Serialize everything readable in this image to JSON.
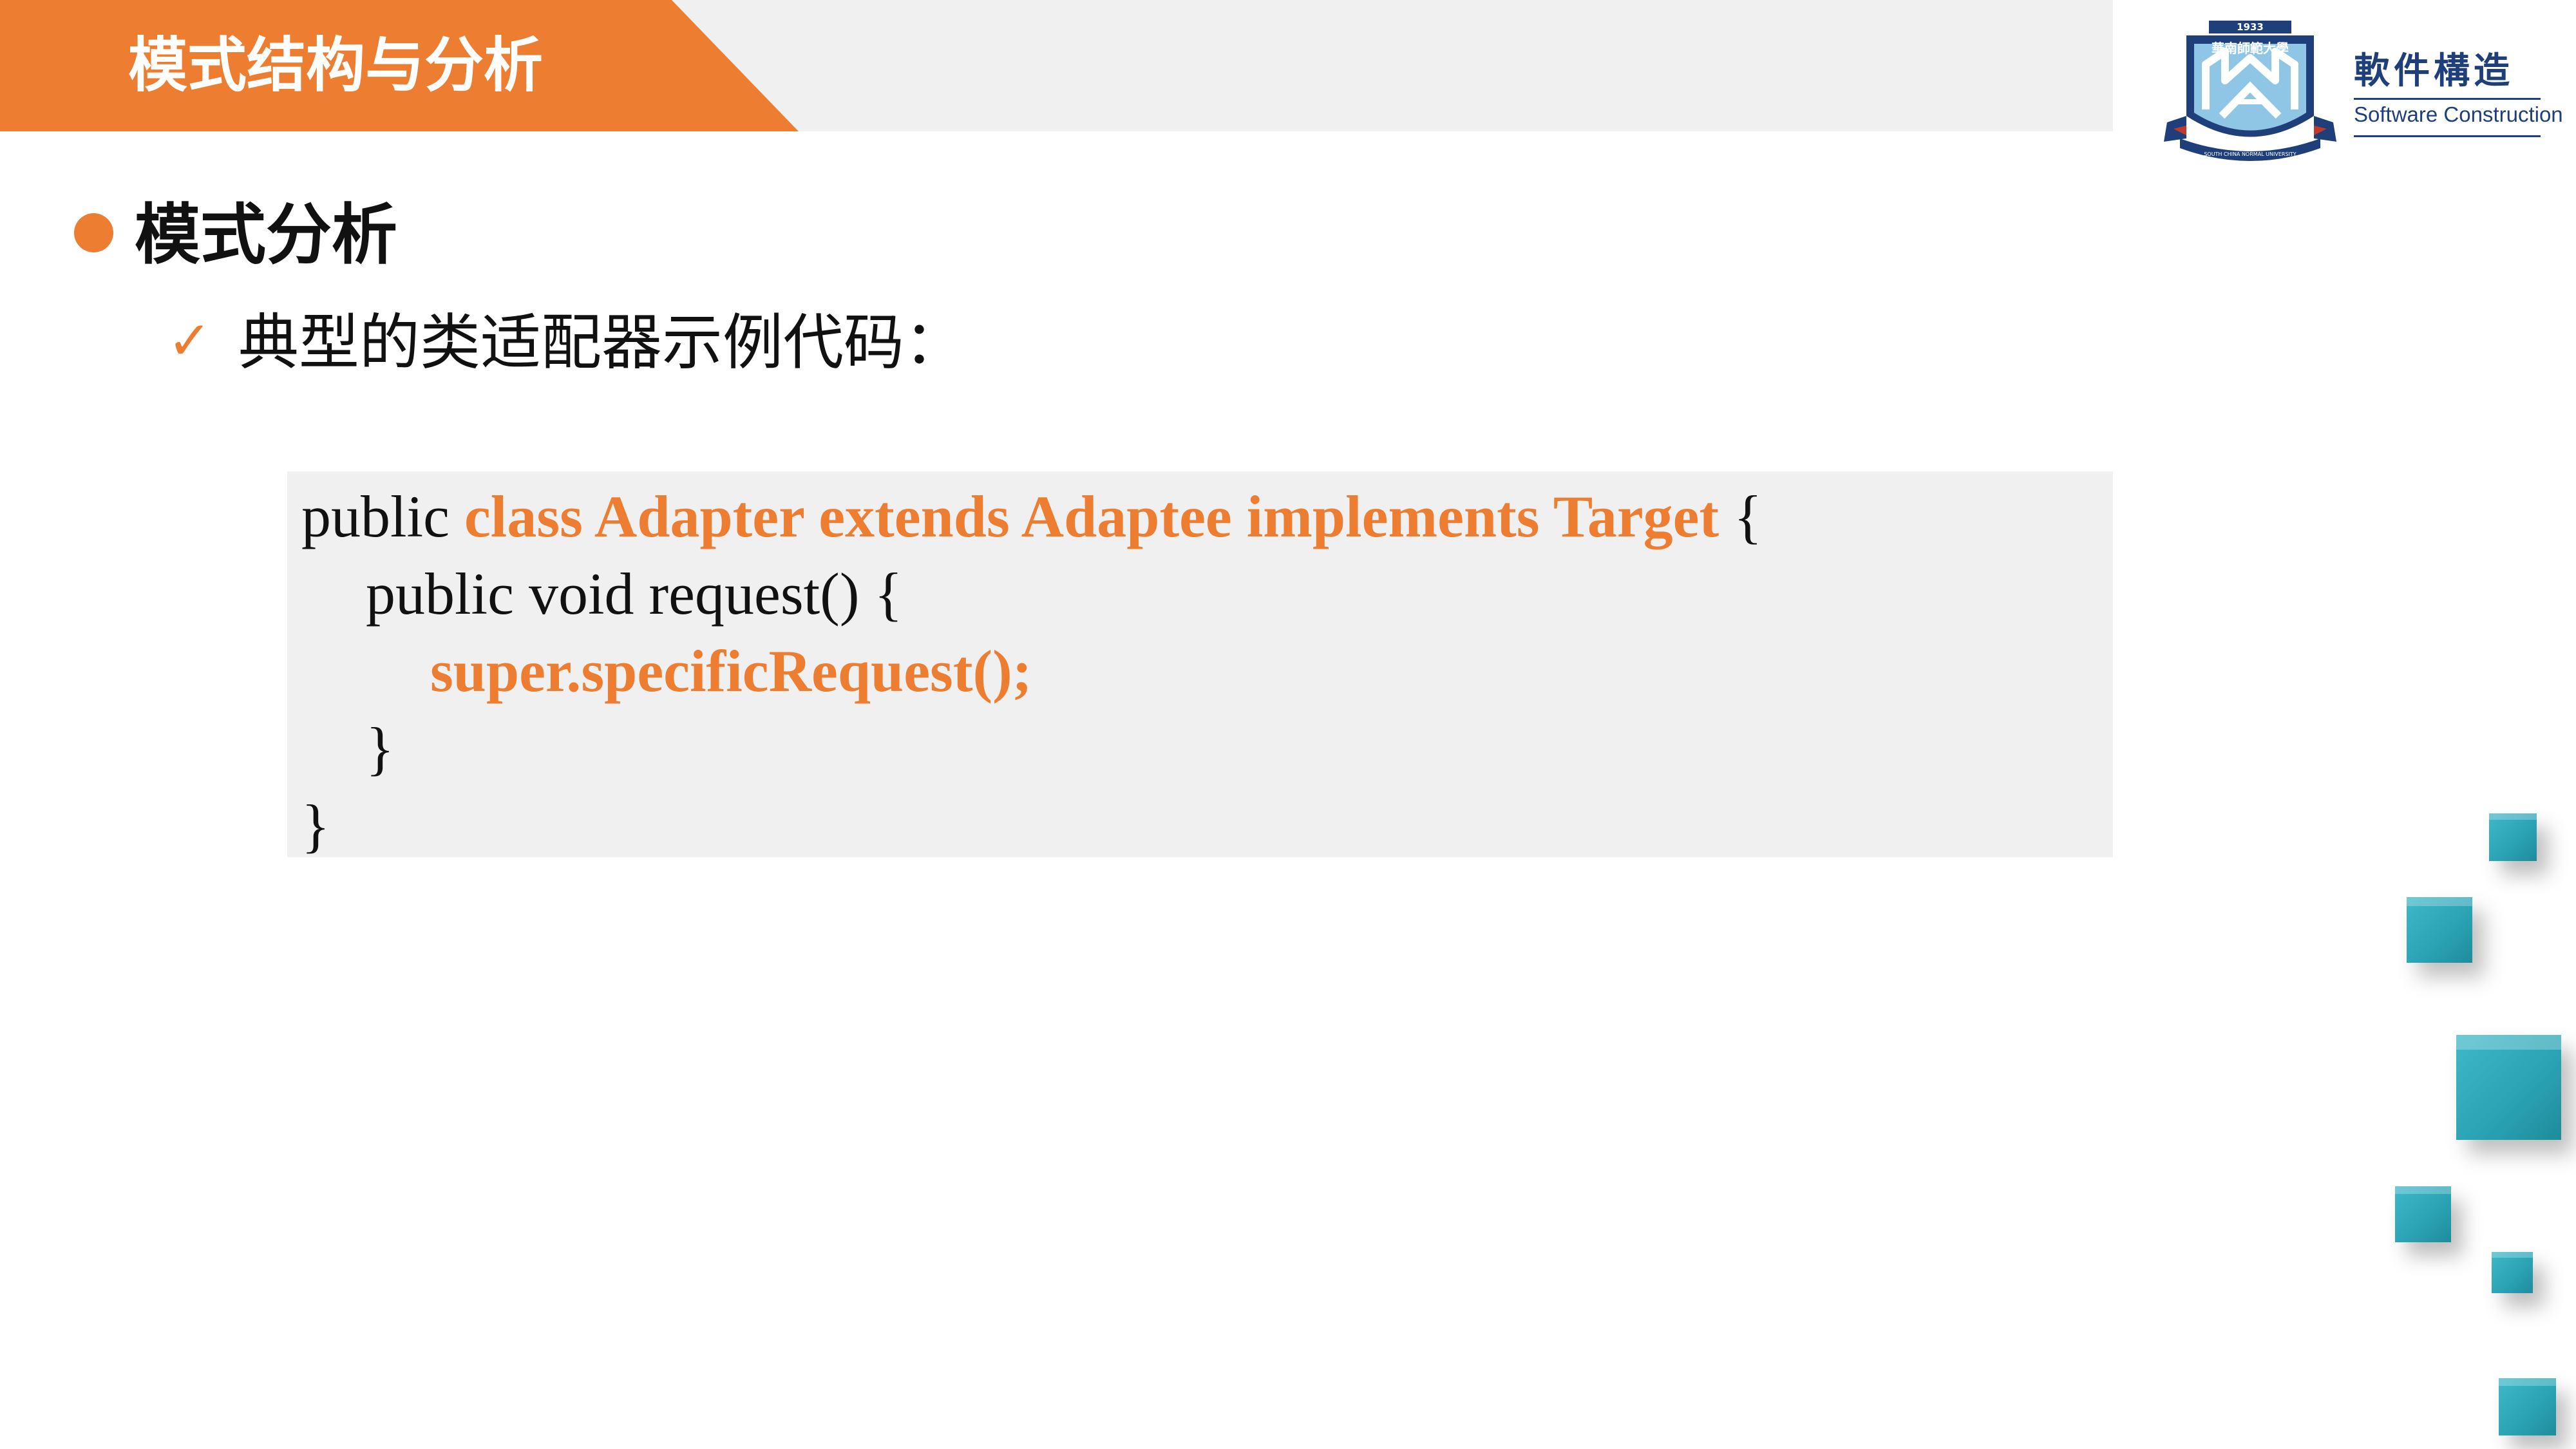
{
  "header": {
    "title": "模式结构与分析"
  },
  "logo": {
    "emblem_year": "1933",
    "emblem_name": "華南師範大學",
    "emblem_ribbon": "SOUTH CHINA NORMAL UNIVERSITY",
    "title_cn": "軟件構造",
    "title_en": "Software Construction"
  },
  "content": {
    "heading": "模式分析",
    "sub_item": "典型的类适配器示例代码："
  },
  "code": {
    "line1_plain": "public ",
    "line1_highlight": "class Adapter extends Adaptee implements Target",
    "line1_end": " {",
    "line2": "public void request() {",
    "line3_highlight": "super.specificRequest();",
    "line4": "}",
    "line5": "}"
  },
  "colors": {
    "accent": "#ed7d31",
    "header_band": "#f0f0f0",
    "code_background": "#f0f0f0",
    "cube": "#2aa2b3",
    "logo_navy": "#1f3f7a"
  },
  "icons": {
    "bullet": "orange-dot-icon",
    "check": "check-mark-icon"
  }
}
